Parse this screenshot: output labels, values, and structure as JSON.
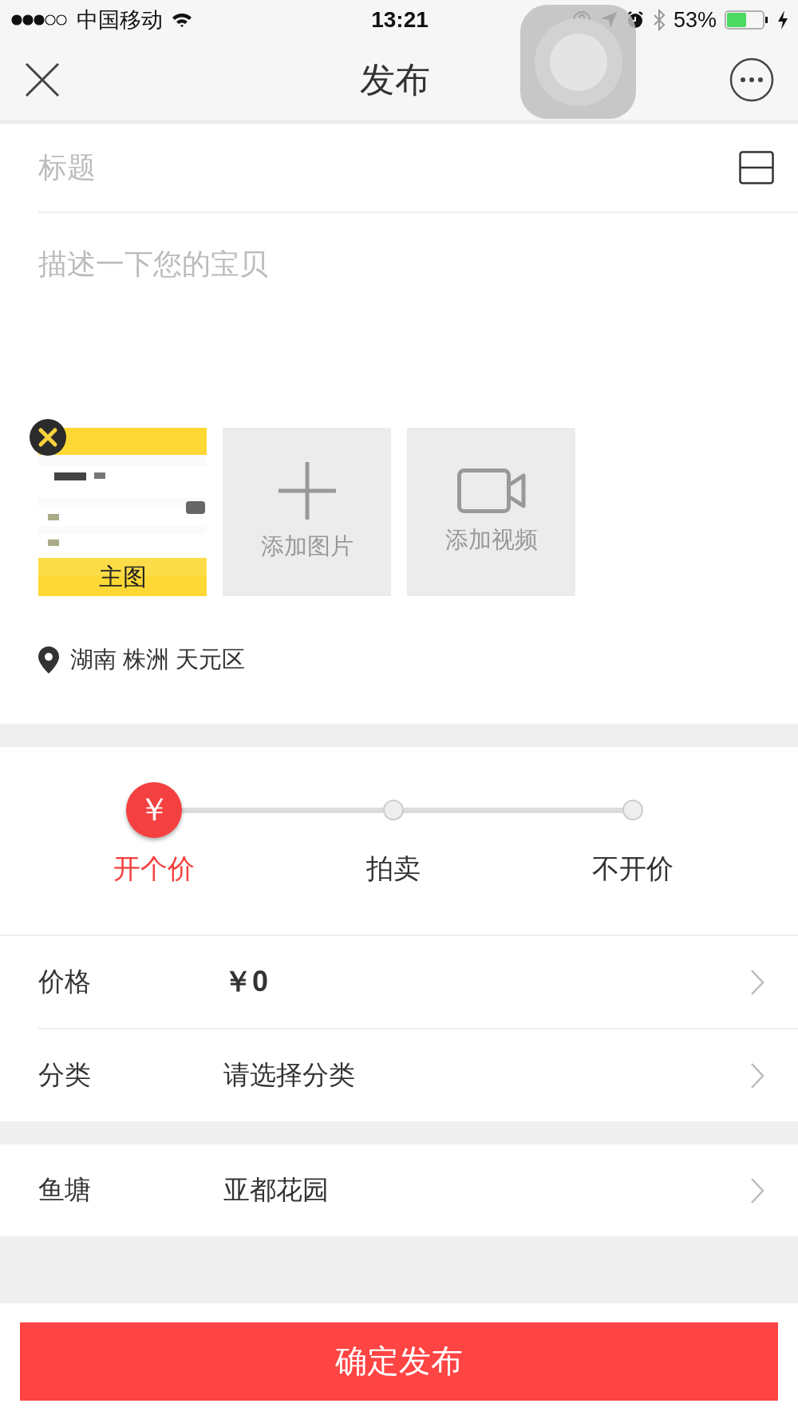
{
  "status_bar": {
    "carrier": "中国移动",
    "time": "13:21",
    "battery": "53%"
  },
  "nav": {
    "title": "发布"
  },
  "title_field": {
    "placeholder": "标题"
  },
  "description_field": {
    "placeholder": "描述一下您的宝贝"
  },
  "media": [
    {
      "kind": "picture",
      "label": "主图"
    },
    {
      "kind": "add_image",
      "label": "添加图片"
    },
    {
      "kind": "add_video",
      "label": "添加视频"
    }
  ],
  "location": "湖南 株洲 天元区",
  "pricing": {
    "marker": "￥",
    "options": [
      {
        "label": "开个价",
        "selected": true
      },
      {
        "label": "拍卖",
        "selected": false
      },
      {
        "label": "不开价",
        "selected": false
      }
    ]
  },
  "groups": [
    [
      {
        "label": "价格",
        "value": "￥0",
        "kind": "price"
      },
      {
        "label": "分类",
        "value": "请选择分类",
        "kind": "select"
      }
    ],
    [
      {
        "label": "鱼塘",
        "value": "亚都花园",
        "kind": "select"
      }
    ]
  ],
  "submit_button": "确定发布"
}
